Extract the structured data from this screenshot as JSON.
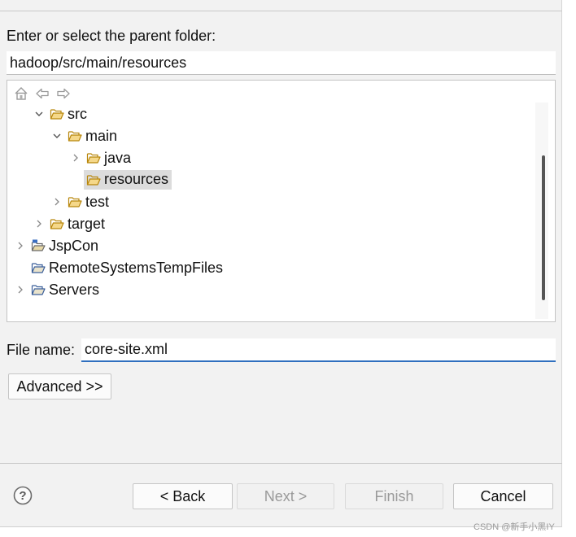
{
  "parent_folder": {
    "label": "Enter or select the parent folder:",
    "value": "hadoop/src/main/resources"
  },
  "toolbar": {
    "icons": [
      "home-icon",
      "back-arrow-icon",
      "forward-arrow-icon"
    ]
  },
  "tree": {
    "items": [
      {
        "label": "src",
        "expander": "expanded",
        "icon": "folder-open-icon"
      },
      {
        "label": "main",
        "expander": "expanded",
        "icon": "folder-open-icon"
      },
      {
        "label": "java",
        "expander": "collapsed",
        "icon": "folder-open-icon"
      },
      {
        "label": "resources",
        "expander": "none",
        "icon": "folder-open-icon",
        "selected": true
      },
      {
        "label": "test",
        "expander": "collapsed",
        "icon": "folder-open-icon"
      },
      {
        "label": "target",
        "expander": "collapsed",
        "icon": "folder-open-icon"
      },
      {
        "label": "JspCon",
        "expander": "collapsed",
        "icon": "project-icon"
      },
      {
        "label": "RemoteSystemsTempFiles",
        "expander": "none",
        "icon": "project-folder-icon"
      },
      {
        "label": "Servers",
        "expander": "collapsed",
        "icon": "project-folder-icon"
      }
    ]
  },
  "file_name": {
    "label": "File name:",
    "value": "core-site.xml"
  },
  "buttons": {
    "advanced": "Advanced >>",
    "back": "< Back",
    "next": "Next >",
    "finish": "Finish",
    "cancel": "Cancel"
  },
  "watermark": "CSDN @新手小黑IY",
  "colors": {
    "dialog_bg": "#f2f2f2",
    "focus_underline": "#2f6fbf",
    "folder_fill": "#f5d88a",
    "folder_stroke": "#b8860b",
    "selection_bg": "#dcdcdc"
  }
}
